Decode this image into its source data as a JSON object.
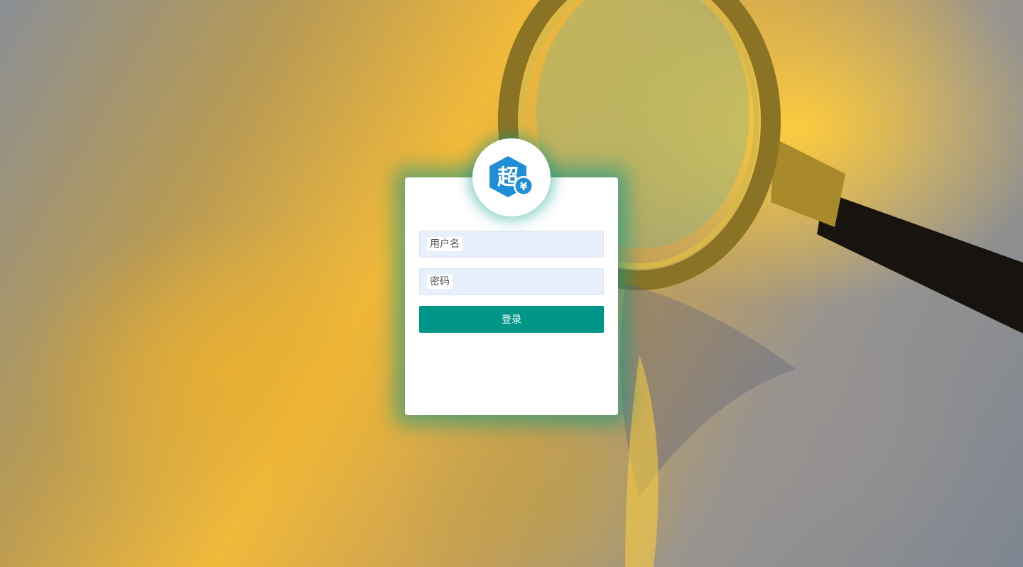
{
  "logo": {
    "glyph": "超",
    "badge_symbol": "¥",
    "hex_color": "#1f8ed6"
  },
  "form": {
    "username_placeholder": "用户名",
    "password_placeholder": "密码",
    "login_label": "登录"
  },
  "colors": {
    "accent": "#009688",
    "input_bg": "#e8f0fe"
  }
}
